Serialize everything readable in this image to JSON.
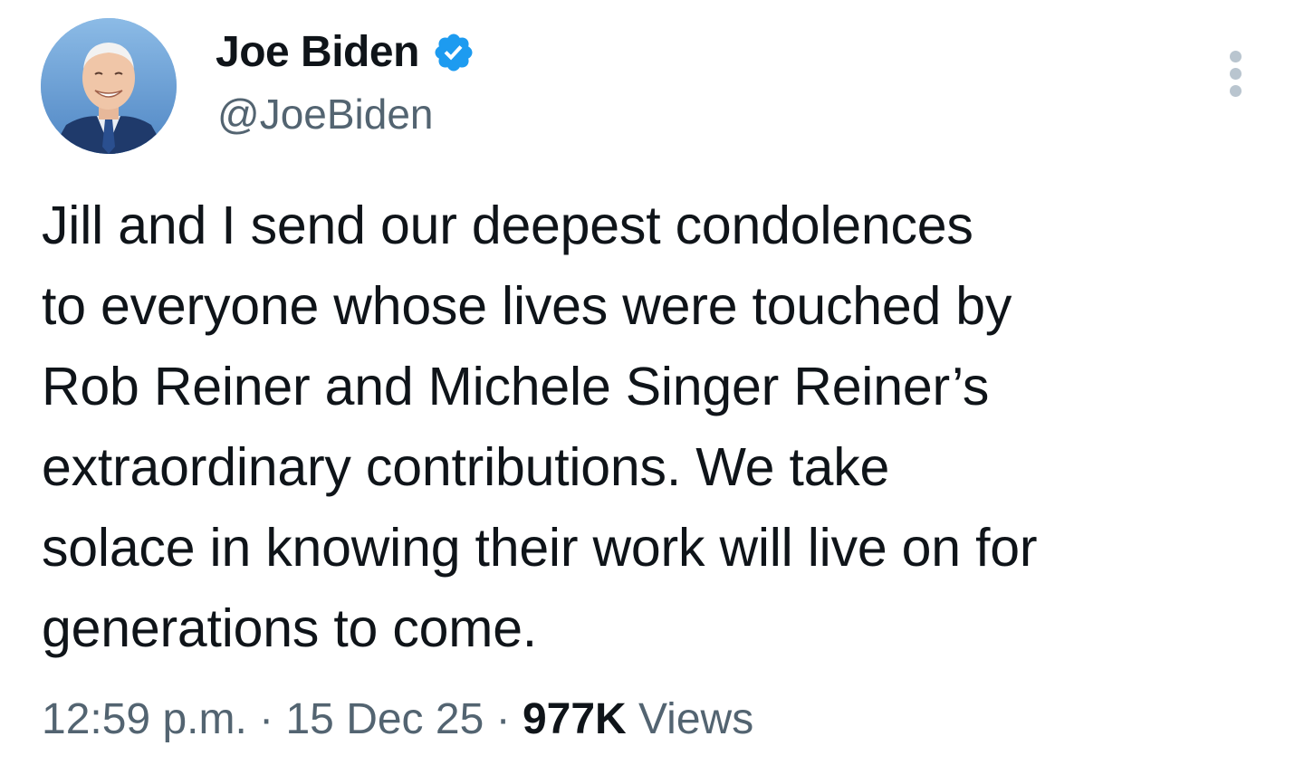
{
  "author": {
    "display_name": "Joe Biden",
    "handle": "@JoeBiden",
    "verified": true,
    "verified_color": "#1d9bf0"
  },
  "tweet": {
    "text": "Jill and I send our deepest condolences\nto everyone whose lives were touched by\nRob Reiner and Michele Singer Reiner’s\nextraordinary contributions. We take\nsolace in knowing their work will live on for\ngenerations to come."
  },
  "meta": {
    "time": "12:59 p.m.",
    "separator": " · ",
    "date": "15 Dec 25",
    "views_count": "977K",
    "views_label": " Views"
  },
  "icons": {
    "more": "more-vertical-icon",
    "verified": "verified-badge-icon"
  }
}
